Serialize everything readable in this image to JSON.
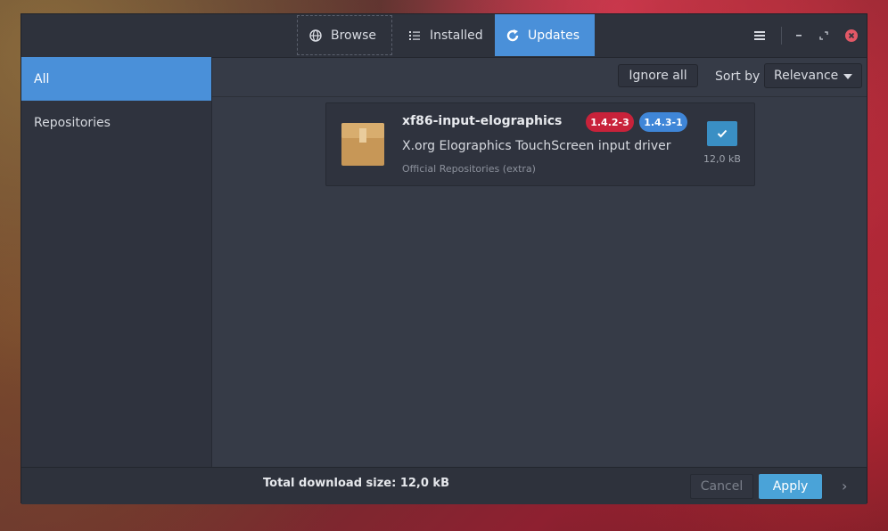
{
  "header": {
    "tabs": [
      {
        "label": "Browse",
        "icon": "globe-icon",
        "state": "focused"
      },
      {
        "label": "Installed",
        "icon": "list-icon",
        "state": "normal"
      },
      {
        "label": "Updates",
        "icon": "refresh-icon",
        "state": "active"
      }
    ],
    "menu_icon": "hamburger-menu-icon",
    "window_controls": [
      "minimize-icon",
      "restore-icon",
      "close-icon"
    ]
  },
  "sidebar": {
    "items": [
      {
        "label": "All",
        "active": true
      },
      {
        "label": "Repositories",
        "active": false
      }
    ]
  },
  "toolbar": {
    "ignore_all_label": "Ignore all",
    "sort_label": "Sort by",
    "sort_value": "Relevance"
  },
  "packages": [
    {
      "name": "xf86-input-elographics",
      "old_version": "1.4.2-3",
      "new_version": "1.4.3-1",
      "description": "X.org Elographics TouchScreen input driver",
      "repository": "Official Repositories (extra)",
      "size": "12,0 kB",
      "selected": true,
      "icon": "package-box-icon"
    }
  ],
  "footer": {
    "total_download": "Total download size: 12,0 kB",
    "cancel_label": "Cancel",
    "apply_label": "Apply",
    "next_glyph": "›"
  },
  "colors": {
    "accent": "#4a90d9",
    "old_version_badge": "#c8223a",
    "new_version_badge": "#3f86d8",
    "apply_button": "#4aa3d8",
    "window_bg": "#363b47"
  }
}
